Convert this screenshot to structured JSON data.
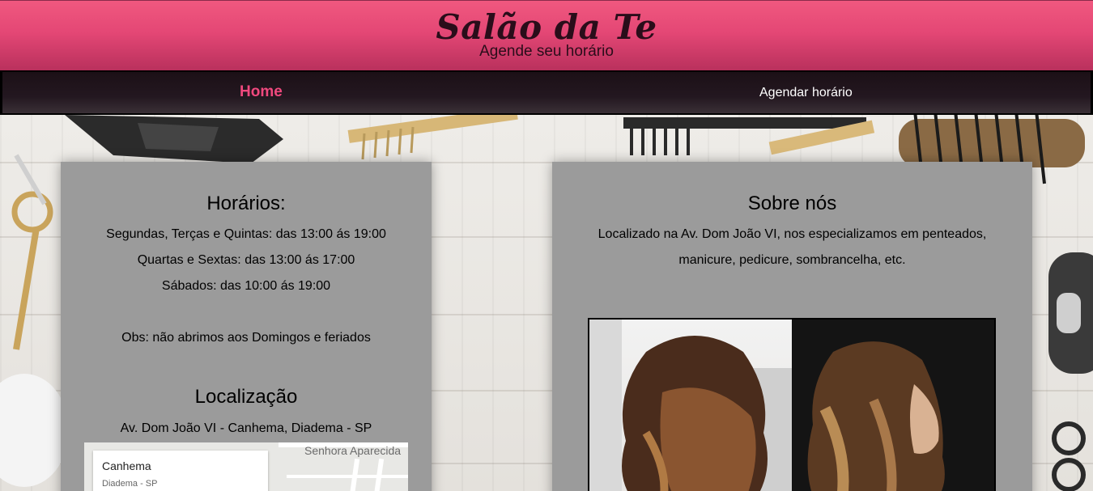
{
  "header": {
    "brand": "Salão da Te",
    "tagline": "Agende seu horário"
  },
  "nav": {
    "items": [
      {
        "label": "Home",
        "active": true
      },
      {
        "label": "Agendar horário",
        "active": false
      }
    ]
  },
  "horarios": {
    "title": "Horários:",
    "lines": [
      "Segundas, Terças e Quintas: das 13:00 ás 19:00",
      "Quartas e Sextas: das 13:00 ás 17:00",
      "Sábados: das 10:00 ás 19:00"
    ],
    "note": "Obs: não abrimos aos Domingos e feriados"
  },
  "localizacao": {
    "title": "Localização",
    "address": "Av. Dom João VI - Canhema, Diadema - SP",
    "map": {
      "place": "Canhema",
      "place_sub": "Diadema - SP",
      "area_label": "Senhora Aparecida"
    }
  },
  "sobre": {
    "title": "Sobre nós",
    "text_line1": "Localizado na Av. Dom João VI, nos especializamos em penteados,",
    "text_line2": "manicure, pedicure, sombrancelha, etc."
  },
  "colors": {
    "header_pink": "#e44775",
    "nav_dark": "#1c1016",
    "nav_active": "#f0497e",
    "card_gray": "#9b9b9b"
  }
}
